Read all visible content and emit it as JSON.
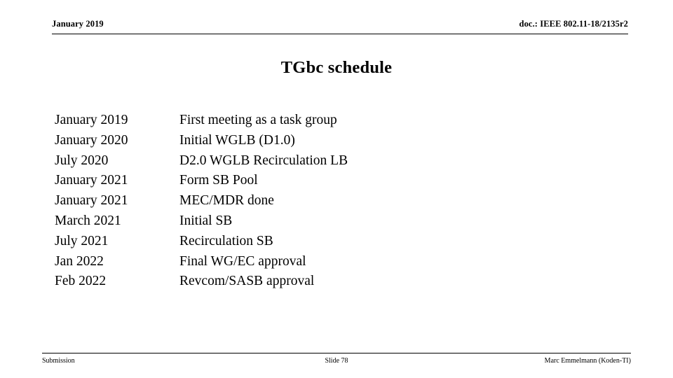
{
  "header": {
    "left": "January 2019",
    "right": "doc.: IEEE 802.11-18/2135r2"
  },
  "title": "TGbc schedule",
  "schedule": {
    "rows": [
      {
        "date": "January 2019",
        "milestone": "First meeting as a task group"
      },
      {
        "date": "January 2020",
        "milestone": "Initial WGLB (D1.0)"
      },
      {
        "date": "July 2020",
        "milestone": "D2.0 WGLB Recirculation LB"
      },
      {
        "date": "January 2021",
        "milestone": "Form SB Pool"
      },
      {
        "date": "January 2021",
        "milestone": "MEC/MDR done"
      },
      {
        "date": "March 2021",
        "milestone": "Initial SB"
      },
      {
        "date": "July 2021",
        "milestone": "Recirculation SB"
      },
      {
        "date": "Jan 2022",
        "milestone": "Final WG/EC approval"
      },
      {
        "date": "Feb 2022",
        "milestone": "Revcom/SASB approval"
      }
    ]
  },
  "footer": {
    "left": "Submission",
    "center": "Slide 78",
    "right": "Marc Emmelmann (Koden-TI)"
  },
  "colors": {
    "text": "#000000",
    "background": "#ffffff",
    "rule": "#000000"
  }
}
